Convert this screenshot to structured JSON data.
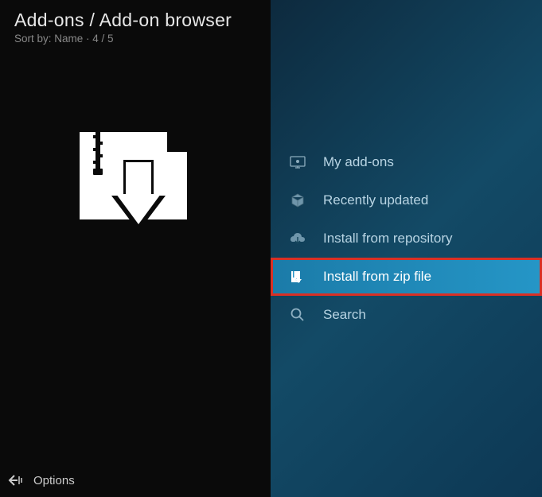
{
  "header": {
    "title": "Add-ons / Add-on browser",
    "subtitle": "Sort by: Name  ·  4 / 5"
  },
  "menu": {
    "items": [
      {
        "label": "My add-ons",
        "icon": "monitor-addons-icon"
      },
      {
        "label": "Recently updated",
        "icon": "box-icon"
      },
      {
        "label": "Install from repository",
        "icon": "cloud-download-icon"
      },
      {
        "label": "Install from zip file",
        "icon": "zip-install-icon"
      },
      {
        "label": "Search",
        "icon": "search-icon"
      }
    ]
  },
  "footer": {
    "options_label": "Options"
  }
}
